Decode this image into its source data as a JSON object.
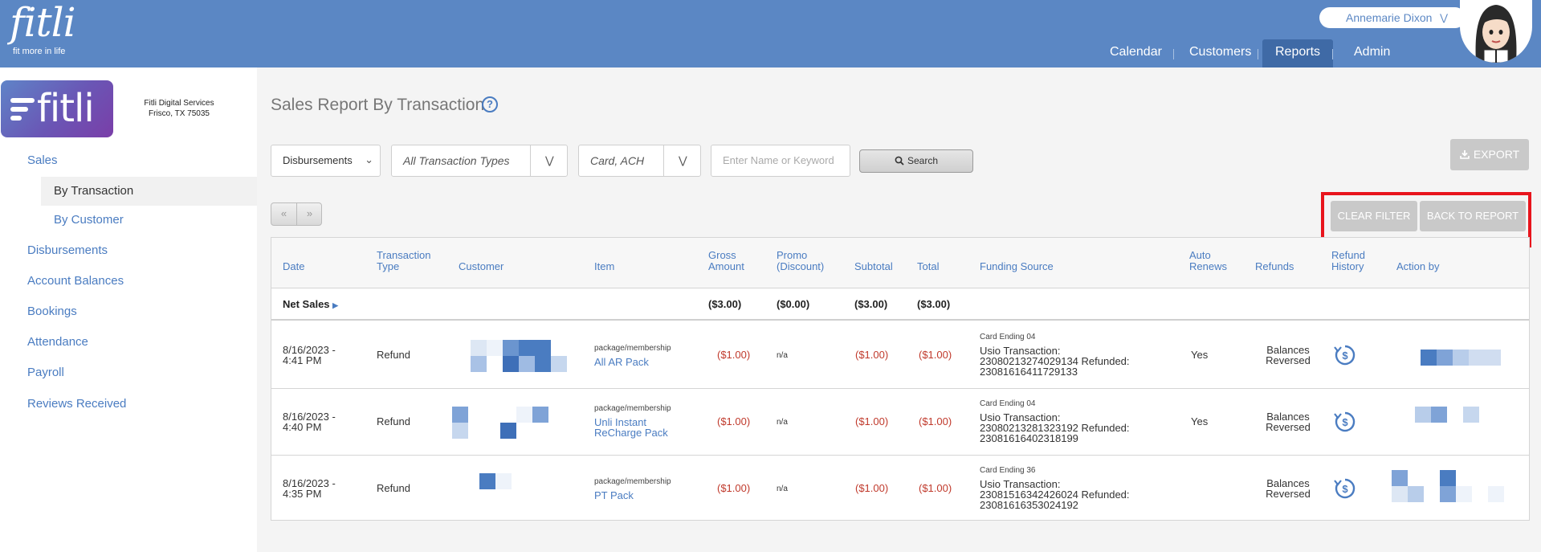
{
  "header": {
    "logo_word": "fitli",
    "logo_tagline": "fit more in life",
    "user_name": "Annemarie Dixon",
    "nav": [
      "Calendar",
      "Customers",
      "Reports",
      "Admin"
    ],
    "active_nav": "Reports"
  },
  "brand": {
    "word": "fitli",
    "company_name": "Fitli Digital Services",
    "company_location": "Frisco, TX 75035"
  },
  "sidebar": {
    "items": [
      "Sales",
      "By Transaction",
      "By Customer",
      "Disbursements",
      "Account Balances",
      "Bookings",
      "Attendance",
      "Payroll",
      "Reviews Received"
    ],
    "active_item": "By Transaction"
  },
  "page": {
    "title": "Sales Report By Transaction",
    "help_icon": "?"
  },
  "filters": {
    "report_select": "Disbursements",
    "transaction_types": "All Transaction Types",
    "payment_methods": "Card, ACH",
    "search_placeholder": "Enter Name or Keyword",
    "search_label": "Search",
    "export_label": "EXPORT"
  },
  "pager": {
    "prev": "«",
    "next": "»"
  },
  "actions": {
    "clear_filter": "CLEAR FILTER",
    "back_to_report": "BACK TO REPORT"
  },
  "table": {
    "headers": {
      "date": "Date",
      "type": [
        "Transaction",
        "Type"
      ],
      "customer": "Customer",
      "item": "Item",
      "gross": [
        "Gross",
        "Amount"
      ],
      "promo": [
        "Promo",
        "(Discount)"
      ],
      "subtotal": "Subtotal",
      "total": "Total",
      "funding": "Funding Source",
      "auto": [
        "Auto",
        "Renews"
      ],
      "refunds": "Refunds",
      "history": [
        "Refund",
        "History"
      ],
      "action_by": "Action by"
    },
    "net": {
      "label": "Net Sales",
      "gross": "($3.00)",
      "promo": "($0.00)",
      "subtotal": "($3.00)",
      "total": "($3.00)"
    },
    "rows": [
      {
        "date": [
          "8/16/2023 -",
          "4:41 PM"
        ],
        "type": "Refund",
        "item_cat": "package/membership",
        "item": [
          "All AR Pack"
        ],
        "gross": "($1.00)",
        "promo": "n/a",
        "subtotal": "($1.00)",
        "total": "($1.00)",
        "card": "Card Ending 04",
        "funding": [
          "Usio Transaction:",
          "23080213274029134 Refunded:",
          "23081616411729133"
        ],
        "auto": "Yes",
        "refunds": [
          "Balances",
          "Reversed"
        ]
      },
      {
        "date": [
          "8/16/2023 -",
          "4:40 PM"
        ],
        "type": "Refund",
        "item_cat": "package/membership",
        "item": [
          "Unli Instant",
          "ReCharge Pack"
        ],
        "gross": "($1.00)",
        "promo": "n/a",
        "subtotal": "($1.00)",
        "total": "($1.00)",
        "card": "Card Ending 04",
        "funding": [
          "Usio Transaction:",
          "23080213281323192 Refunded:",
          "23081616402318199"
        ],
        "auto": "Yes",
        "refunds": [
          "Balances",
          "Reversed"
        ]
      },
      {
        "date": [
          "8/16/2023 -",
          "4:35 PM"
        ],
        "type": "Refund",
        "item_cat": "package/membership",
        "item": [
          "PT Pack"
        ],
        "gross": "($1.00)",
        "promo": "n/a",
        "subtotal": "($1.00)",
        "total": "($1.00)",
        "card": "Card Ending 36",
        "funding": [
          "Usio Transaction:",
          "23081516342426024 Refunded:",
          "23081616353024192"
        ],
        "auto": "",
        "refunds": [
          "Balances",
          "Reversed"
        ]
      }
    ]
  },
  "colors": {
    "header_blue": "#5b87c4",
    "nav_active": "#3f6aa6",
    "link_blue": "#4a7cc1",
    "negative_red": "#c0392b",
    "highlight_red": "#e8141c",
    "disabled_gray": "#c9c9c9"
  }
}
